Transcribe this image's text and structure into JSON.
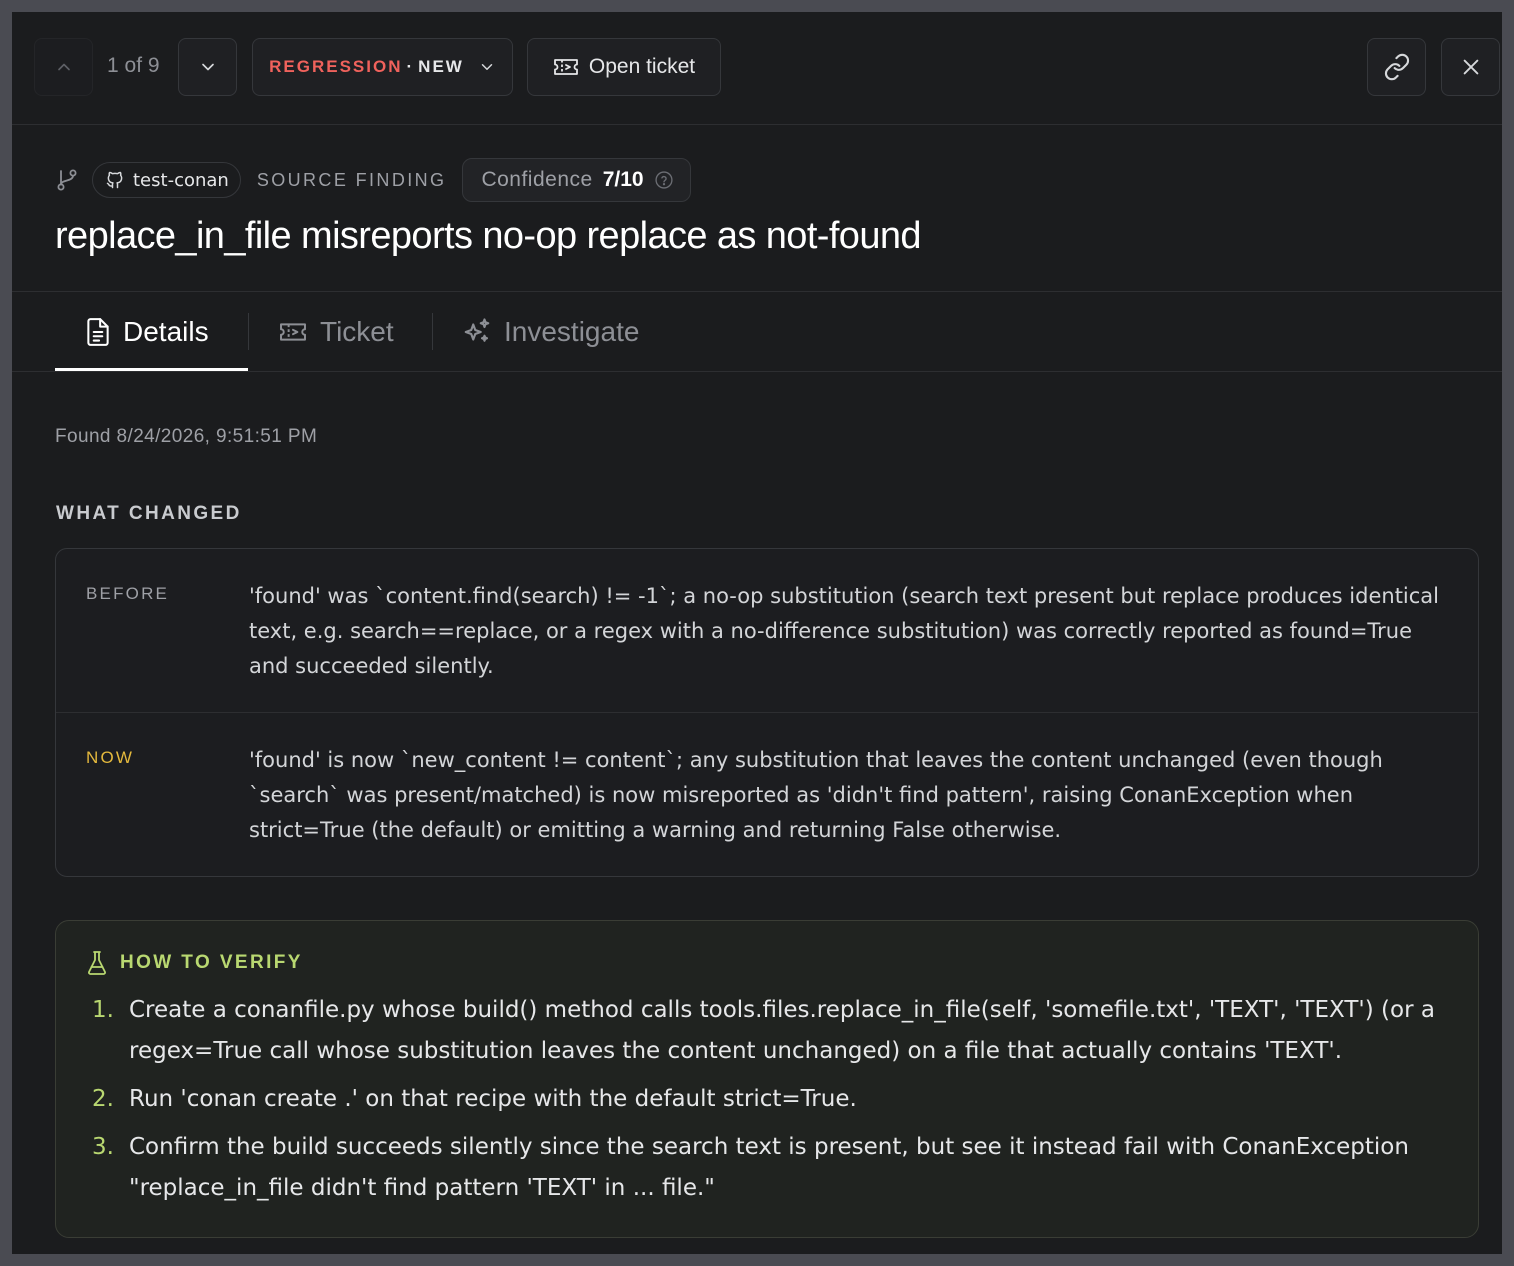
{
  "toolbar": {
    "position": "1 of 9",
    "status_category": "REGRESSION",
    "status_separator": "·",
    "status_state": "NEW",
    "open_ticket_label": "Open ticket"
  },
  "finding": {
    "repo": "test-conan",
    "source_label": "SOURCE FINDING",
    "confidence_label": "Confidence",
    "confidence_value": "7/10",
    "title": "replace_in_file misreports no-op replace as not-found"
  },
  "tabs": [
    {
      "label": "Details",
      "icon": "document-icon",
      "active": true
    },
    {
      "label": "Ticket",
      "icon": "ticket-icon",
      "active": false
    },
    {
      "label": "Investigate",
      "icon": "sparkles-icon",
      "active": false
    }
  ],
  "details": {
    "found": "Found 8/24/2026, 9:51:51 PM",
    "what_changed_label": "WHAT CHANGED",
    "before_label": "BEFORE",
    "before_text": "'found' was `content.find(search) != -1`; a no-op substitution (search text present but replace produces identical text, e.g. search==replace, or a regex with a no-difference substitution) was correctly reported as found=True and succeeded silently.",
    "now_label": "NOW",
    "now_text": "'found' is now `new_content != content`; any substitution that leaves the content unchanged (even though `search` was present/matched) is now misreported as 'didn't find pattern', raising ConanException when strict=True (the default) or emitting a warning and returning False otherwise.",
    "verify_label": "HOW TO VERIFY",
    "steps": [
      {
        "num": "1.",
        "text": "Create a conanfile.py whose build() method calls tools.files.replace_in_file(self, 'somefile.txt', 'TEXT', 'TEXT') (or a regex=True call whose substitution leaves the content unchanged) on a file that actually contains 'TEXT'."
      },
      {
        "num": "2.",
        "text": "Run 'conan create .' on that recipe with the default strict=True."
      },
      {
        "num": "3.",
        "text": "Confirm the build succeeds silently since the search text is present, but see it instead fail with ConanException \"replace_in_file didn't find pattern 'TEXT' in ... file.\""
      }
    ]
  },
  "colors": {
    "regression": "#f0625c",
    "now_accent": "#e4b93d",
    "verify_accent": "#b9d871"
  }
}
